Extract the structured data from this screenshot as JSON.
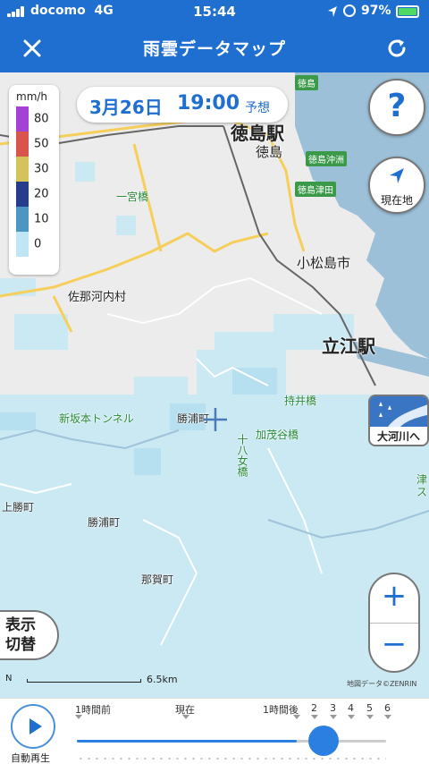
{
  "status_bar": {
    "carrier": "docomo",
    "network": "4G",
    "time": "15:44",
    "battery_percent": "97%",
    "battery_color": "#4cd964"
  },
  "header": {
    "title": "雨雲データマップ",
    "close_icon": "close-icon",
    "refresh_icon": "refresh-icon",
    "background": "#1e6fd0"
  },
  "legend": {
    "unit": "mm/h",
    "items": [
      {
        "value": "80",
        "color": "#a542d6"
      },
      {
        "value": "50",
        "color": "#d9544d"
      },
      {
        "value": "30",
        "color": "#d4c35a"
      },
      {
        "value": "20",
        "color": "#283c8c"
      },
      {
        "value": "10",
        "color": "#4b97c2"
      },
      {
        "value": "0",
        "color": "#bfe6f5"
      }
    ]
  },
  "time_pill": {
    "date": "3月26日",
    "time": "19:00",
    "mode": "予想"
  },
  "map_labels": {
    "tokushima_station": "徳島駅",
    "tokushima": "徳島",
    "tokushima_okisu": "徳島沖洲",
    "tokushima_tsuda": "徳島津田",
    "tokushima_top": "徳島",
    "ichinomiya_bridge": "一宮橋",
    "komatsushima_city": "小松島市",
    "sanagochi": "佐那河内村",
    "tatsue_station": "立江駅",
    "mochiibashi": "持井橋",
    "shinsakamoto_tunnel": "新坂本トンネル",
    "katsuura_town": "勝浦町",
    "kamoyabashi": "加茂谷橋",
    "juhachimejo": "十八女橋",
    "kamikatsu_town": "上勝町",
    "katsuura_town_2": "勝浦町",
    "naka_town": "那賀町",
    "edge_right": "津\nス"
  },
  "buttons": {
    "help": "?",
    "locate": "現在地",
    "river": "大河川へ",
    "zoom_in": "+",
    "zoom_out": "−",
    "display_toggle_line1": "表示",
    "display_toggle_line2": "切替"
  },
  "scale": {
    "north": "N",
    "distance": "6.5km"
  },
  "credit": "地図データ©ZENRIN",
  "timeline": {
    "play_label": "自動再生",
    "labels": [
      "1時間前",
      "現在",
      "1時間後",
      "2",
      "3",
      "4",
      "5",
      "6"
    ],
    "progress": 0.71
  }
}
